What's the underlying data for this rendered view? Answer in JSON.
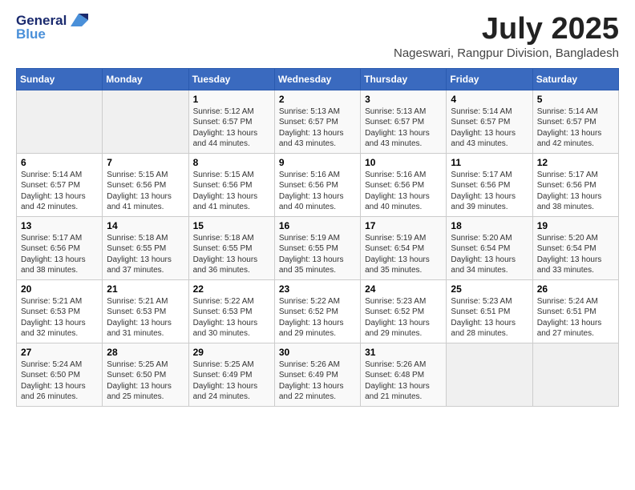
{
  "header": {
    "logo_general": "General",
    "logo_blue": "Blue",
    "month": "July 2025",
    "location": "Nageswari, Rangpur Division, Bangladesh"
  },
  "days_of_week": [
    "Sunday",
    "Monday",
    "Tuesday",
    "Wednesday",
    "Thursday",
    "Friday",
    "Saturday"
  ],
  "weeks": [
    [
      {
        "day": "",
        "sunrise": "",
        "sunset": "",
        "daylight": ""
      },
      {
        "day": "",
        "sunrise": "",
        "sunset": "",
        "daylight": ""
      },
      {
        "day": "1",
        "sunrise": "Sunrise: 5:12 AM",
        "sunset": "Sunset: 6:57 PM",
        "daylight": "Daylight: 13 hours and 44 minutes."
      },
      {
        "day": "2",
        "sunrise": "Sunrise: 5:13 AM",
        "sunset": "Sunset: 6:57 PM",
        "daylight": "Daylight: 13 hours and 43 minutes."
      },
      {
        "day": "3",
        "sunrise": "Sunrise: 5:13 AM",
        "sunset": "Sunset: 6:57 PM",
        "daylight": "Daylight: 13 hours and 43 minutes."
      },
      {
        "day": "4",
        "sunrise": "Sunrise: 5:14 AM",
        "sunset": "Sunset: 6:57 PM",
        "daylight": "Daylight: 13 hours and 43 minutes."
      },
      {
        "day": "5",
        "sunrise": "Sunrise: 5:14 AM",
        "sunset": "Sunset: 6:57 PM",
        "daylight": "Daylight: 13 hours and 42 minutes."
      }
    ],
    [
      {
        "day": "6",
        "sunrise": "Sunrise: 5:14 AM",
        "sunset": "Sunset: 6:57 PM",
        "daylight": "Daylight: 13 hours and 42 minutes."
      },
      {
        "day": "7",
        "sunrise": "Sunrise: 5:15 AM",
        "sunset": "Sunset: 6:56 PM",
        "daylight": "Daylight: 13 hours and 41 minutes."
      },
      {
        "day": "8",
        "sunrise": "Sunrise: 5:15 AM",
        "sunset": "Sunset: 6:56 PM",
        "daylight": "Daylight: 13 hours and 41 minutes."
      },
      {
        "day": "9",
        "sunrise": "Sunrise: 5:16 AM",
        "sunset": "Sunset: 6:56 PM",
        "daylight": "Daylight: 13 hours and 40 minutes."
      },
      {
        "day": "10",
        "sunrise": "Sunrise: 5:16 AM",
        "sunset": "Sunset: 6:56 PM",
        "daylight": "Daylight: 13 hours and 40 minutes."
      },
      {
        "day": "11",
        "sunrise": "Sunrise: 5:17 AM",
        "sunset": "Sunset: 6:56 PM",
        "daylight": "Daylight: 13 hours and 39 minutes."
      },
      {
        "day": "12",
        "sunrise": "Sunrise: 5:17 AM",
        "sunset": "Sunset: 6:56 PM",
        "daylight": "Daylight: 13 hours and 38 minutes."
      }
    ],
    [
      {
        "day": "13",
        "sunrise": "Sunrise: 5:17 AM",
        "sunset": "Sunset: 6:56 PM",
        "daylight": "Daylight: 13 hours and 38 minutes."
      },
      {
        "day": "14",
        "sunrise": "Sunrise: 5:18 AM",
        "sunset": "Sunset: 6:55 PM",
        "daylight": "Daylight: 13 hours and 37 minutes."
      },
      {
        "day": "15",
        "sunrise": "Sunrise: 5:18 AM",
        "sunset": "Sunset: 6:55 PM",
        "daylight": "Daylight: 13 hours and 36 minutes."
      },
      {
        "day": "16",
        "sunrise": "Sunrise: 5:19 AM",
        "sunset": "Sunset: 6:55 PM",
        "daylight": "Daylight: 13 hours and 35 minutes."
      },
      {
        "day": "17",
        "sunrise": "Sunrise: 5:19 AM",
        "sunset": "Sunset: 6:54 PM",
        "daylight": "Daylight: 13 hours and 35 minutes."
      },
      {
        "day": "18",
        "sunrise": "Sunrise: 5:20 AM",
        "sunset": "Sunset: 6:54 PM",
        "daylight": "Daylight: 13 hours and 34 minutes."
      },
      {
        "day": "19",
        "sunrise": "Sunrise: 5:20 AM",
        "sunset": "Sunset: 6:54 PM",
        "daylight": "Daylight: 13 hours and 33 minutes."
      }
    ],
    [
      {
        "day": "20",
        "sunrise": "Sunrise: 5:21 AM",
        "sunset": "Sunset: 6:53 PM",
        "daylight": "Daylight: 13 hours and 32 minutes."
      },
      {
        "day": "21",
        "sunrise": "Sunrise: 5:21 AM",
        "sunset": "Sunset: 6:53 PM",
        "daylight": "Daylight: 13 hours and 31 minutes."
      },
      {
        "day": "22",
        "sunrise": "Sunrise: 5:22 AM",
        "sunset": "Sunset: 6:53 PM",
        "daylight": "Daylight: 13 hours and 30 minutes."
      },
      {
        "day": "23",
        "sunrise": "Sunrise: 5:22 AM",
        "sunset": "Sunset: 6:52 PM",
        "daylight": "Daylight: 13 hours and 29 minutes."
      },
      {
        "day": "24",
        "sunrise": "Sunrise: 5:23 AM",
        "sunset": "Sunset: 6:52 PM",
        "daylight": "Daylight: 13 hours and 29 minutes."
      },
      {
        "day": "25",
        "sunrise": "Sunrise: 5:23 AM",
        "sunset": "Sunset: 6:51 PM",
        "daylight": "Daylight: 13 hours and 28 minutes."
      },
      {
        "day": "26",
        "sunrise": "Sunrise: 5:24 AM",
        "sunset": "Sunset: 6:51 PM",
        "daylight": "Daylight: 13 hours and 27 minutes."
      }
    ],
    [
      {
        "day": "27",
        "sunrise": "Sunrise: 5:24 AM",
        "sunset": "Sunset: 6:50 PM",
        "daylight": "Daylight: 13 hours and 26 minutes."
      },
      {
        "day": "28",
        "sunrise": "Sunrise: 5:25 AM",
        "sunset": "Sunset: 6:50 PM",
        "daylight": "Daylight: 13 hours and 25 minutes."
      },
      {
        "day": "29",
        "sunrise": "Sunrise: 5:25 AM",
        "sunset": "Sunset: 6:49 PM",
        "daylight": "Daylight: 13 hours and 24 minutes."
      },
      {
        "day": "30",
        "sunrise": "Sunrise: 5:26 AM",
        "sunset": "Sunset: 6:49 PM",
        "daylight": "Daylight: 13 hours and 22 minutes."
      },
      {
        "day": "31",
        "sunrise": "Sunrise: 5:26 AM",
        "sunset": "Sunset: 6:48 PM",
        "daylight": "Daylight: 13 hours and 21 minutes."
      },
      {
        "day": "",
        "sunrise": "",
        "sunset": "",
        "daylight": ""
      },
      {
        "day": "",
        "sunrise": "",
        "sunset": "",
        "daylight": ""
      }
    ]
  ]
}
